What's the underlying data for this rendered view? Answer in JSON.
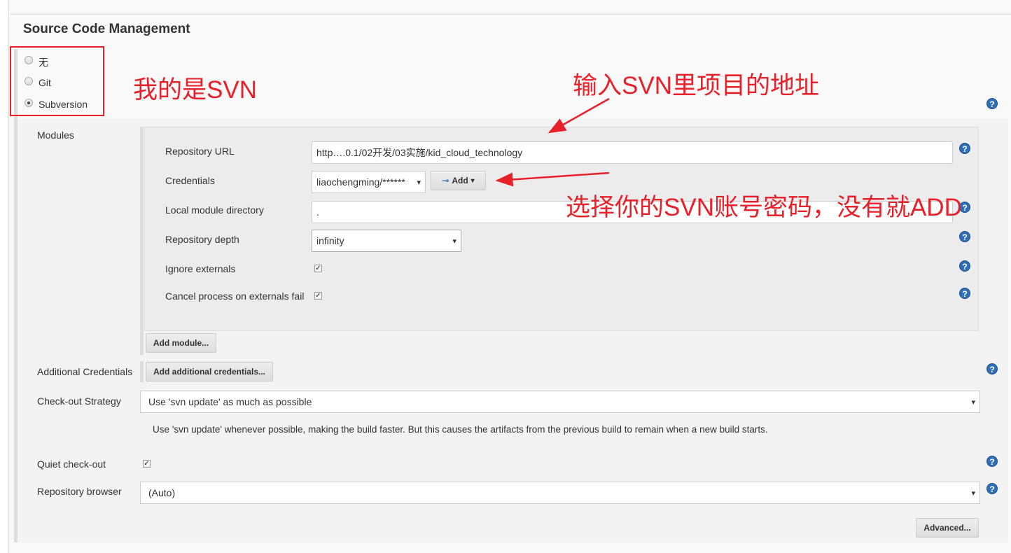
{
  "section_title": "Source Code Management",
  "scm_options": [
    {
      "label": "无",
      "selected": false
    },
    {
      "label": "Git",
      "selected": false
    },
    {
      "label": "Subversion",
      "selected": true
    }
  ],
  "modules": {
    "label": "Modules",
    "repository_url": {
      "label": "Repository URL",
      "value": "http….0.1/02开发/03实施/kid_cloud_technology"
    },
    "credentials": {
      "label": "Credentials",
      "value": "liaochengming/******",
      "add_label": "Add"
    },
    "local_dir": {
      "label": "Local module directory",
      "value": "."
    },
    "depth": {
      "label": "Repository depth",
      "value": "infinity"
    },
    "ignore_externals": {
      "label": "Ignore externals",
      "checked": true
    },
    "cancel_externals": {
      "label": "Cancel process on externals fail",
      "checked": true
    },
    "add_module": "Add module..."
  },
  "additional_credentials": {
    "label": "Additional Credentials",
    "button": "Add additional credentials..."
  },
  "checkout_strategy": {
    "label": "Check-out Strategy",
    "value": "Use 'svn update' as much as possible",
    "description": "Use 'svn update' whenever possible, making the build faster. But this causes the artifacts from the previous build to remain when a new build starts."
  },
  "quiet_checkout": {
    "label": "Quiet check-out",
    "checked": true
  },
  "repo_browser": {
    "label": "Repository browser",
    "value": "(Auto)"
  },
  "advanced": "Advanced...",
  "help_icon": "?",
  "dropdown_arrow": "▾",
  "annotations": {
    "mine": "我的是SVN",
    "input_url": "输入SVN里项目的地址",
    "choose_cred": "选择你的SVN账号密码，没有就ADD",
    "color": "#e8202a"
  }
}
